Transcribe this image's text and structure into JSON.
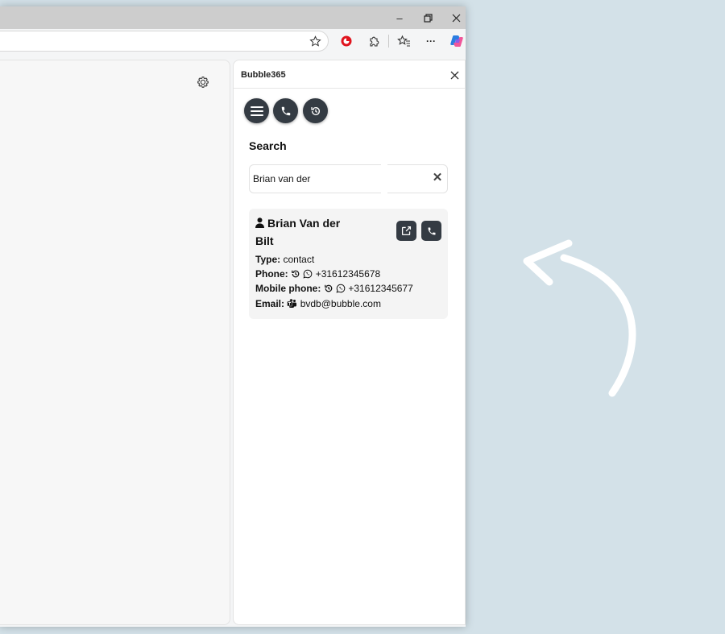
{
  "window": {
    "controls": {
      "minimize": "–",
      "restore": "❐",
      "close": "✕"
    }
  },
  "toolbar": {
    "icons": [
      "favorite-star-icon",
      "extension-red-icon",
      "puzzle-icon",
      "favorites-icon",
      "more-icon",
      "copilot-icon"
    ],
    "more_label": "···"
  },
  "panel": {
    "title": "Bubble365",
    "close_label": "✕",
    "nav_buttons": [
      "menu-icon",
      "phone-icon",
      "history-icon"
    ],
    "search": {
      "label": "Search",
      "value": "Brian van der",
      "clear_label": "✕"
    },
    "result": {
      "name": "Brian Van der Bilt",
      "type_label": "Type:",
      "type_value": "contact",
      "phone_label": "Phone:",
      "phone_value": "+31612345678",
      "mobile_label": "Mobile phone:",
      "mobile_value": "+31612345677",
      "email_label": "Email:",
      "email_value": "bvdb@bubble.com"
    }
  },
  "colors": {
    "background": "#d3e1e8",
    "button_dark": "#343b43",
    "card_bg": "#f4f4f4"
  }
}
